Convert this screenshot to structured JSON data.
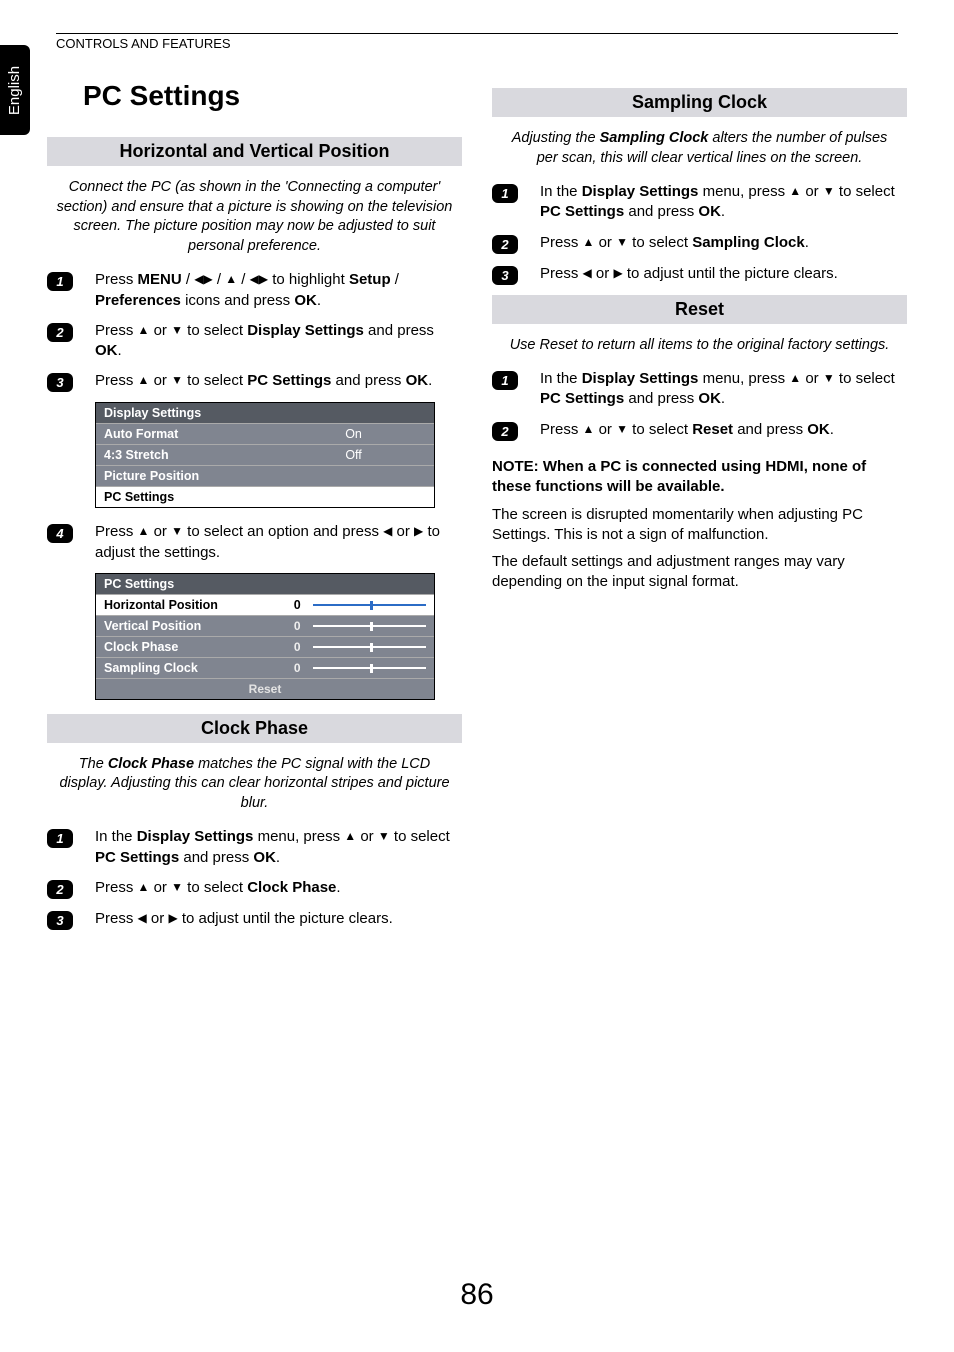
{
  "language_tab": "English",
  "header": "CONTROLS AND FEATURES",
  "page_title": "PC Settings",
  "page_number": "86",
  "icons": {
    "up": "▲",
    "down": "▼",
    "left": "◀",
    "right": "▶"
  },
  "sections": {
    "hvpos": {
      "title": "Horizontal and Vertical Position",
      "intro": "Connect the PC (as shown in the 'Connecting a computer' section) and ensure that a picture is showing on the television screen. The picture position may now be adjusted to suit personal preference.",
      "steps": {
        "s1a": "Press ",
        "s1_menu": "MENU",
        "s1b": " / ",
        "s1c": " to highlight ",
        "s1_setup": "Setup",
        "s1d": " / ",
        "s1_prefs": "Preferences",
        "s1e": " icons and press ",
        "s1_ok": "OK",
        "s1f": ".",
        "s2a": "Press ",
        "s2b": " or ",
        "s2c": " to select ",
        "s2_ds": "Display Settings",
        "s2d": " and press ",
        "s2_ok": "OK",
        "s2e": ".",
        "s3a": "Press ",
        "s3b": " or ",
        "s3c": " to select ",
        "s3_pcs": "PC Settings",
        "s3d": " and press ",
        "s3_ok": "OK",
        "s3e": ".",
        "s4a": "Press ",
        "s4b": " or ",
        "s4c": " to select an option and press ",
        "s4d": " or ",
        "s4e": " to adjust the settings."
      },
      "menu1": {
        "title": "Display Settings",
        "rows": [
          {
            "label": "Auto Format",
            "value": "On"
          },
          {
            "label": "4:3 Stretch",
            "value": "Off"
          },
          {
            "label": "Picture Position",
            "value": ""
          }
        ],
        "highlight": "PC Settings"
      },
      "menu2": {
        "title": "PC Settings",
        "rows": [
          {
            "label": "Horizontal Position",
            "value": "0",
            "slider": 50
          },
          {
            "label": "Vertical Position",
            "value": "0",
            "slider": 50
          },
          {
            "label": "Clock Phase",
            "value": "0",
            "slider": 50
          },
          {
            "label": "Sampling Clock",
            "value": "0",
            "slider": 50
          }
        ],
        "reset": "Reset"
      }
    },
    "clockphase": {
      "title": "Clock Phase",
      "intro_a": "The ",
      "intro_b": "Clock Phase",
      "intro_c": " matches the PC signal with the LCD display. Adjusting this can clear horizontal stripes and picture blur.",
      "steps": {
        "s1a": "In the ",
        "s1_ds": "Display Settings",
        "s1b": " menu, press ",
        "s1c": " or ",
        "s1d": " to select ",
        "s1_pcs": "PC Settings",
        "s1e": " and press ",
        "s1_ok": "OK",
        "s1f": ".",
        "s2a": "Press ",
        "s2b": " or ",
        "s2c": " to select ",
        "s2_cp": "Clock Phase",
        "s2d": ".",
        "s3a": "Press ",
        "s3b": " or ",
        "s3c": " to adjust until the picture clears."
      }
    },
    "samplingclock": {
      "title": "Sampling Clock",
      "intro_a": "Adjusting the ",
      "intro_b": "Sampling Clock",
      "intro_c": " alters the number of pulses per scan, this will clear vertical lines on the screen.",
      "steps": {
        "s1a": "In the ",
        "s1_ds": "Display Settings",
        "s1b": " menu, press ",
        "s1c": " or ",
        "s1d": " to select ",
        "s1_pcs": "PC Settings",
        "s1e": " and press ",
        "s1_ok": "OK",
        "s1f": ".",
        "s2a": "Press ",
        "s2b": " or ",
        "s2c": " to select ",
        "s2_sc": "Sampling Clock",
        "s2d": ".",
        "s3a": "Press ",
        "s3b": " or ",
        "s3c": " to adjust until the picture clears."
      }
    },
    "reset": {
      "title": "Reset",
      "intro": "Use Reset to return all items to the original factory settings.",
      "steps": {
        "s1a": "In the ",
        "s1_ds": "Display Settings",
        "s1b": " menu, press ",
        "s1c": " or ",
        "s1d": " to select ",
        "s1_pcs": "PC Settings",
        "s1e": " and press ",
        "s1_ok": "OK",
        "s1f": ".",
        "s2a": "Press ",
        "s2b": " or ",
        "s2c": " to select ",
        "s2_r": "Reset",
        "s2d": " and press ",
        "s2_ok": "OK",
        "s2e": "."
      }
    },
    "note": {
      "line": "NOTE: When a PC is connected using HDMI, none of these functions will be available.",
      "body1": "The screen is disrupted momentarily when adjusting PC Settings. This is not a sign of malfunction.",
      "body2": "The default settings and adjustment ranges may vary depending on the input signal format."
    }
  }
}
